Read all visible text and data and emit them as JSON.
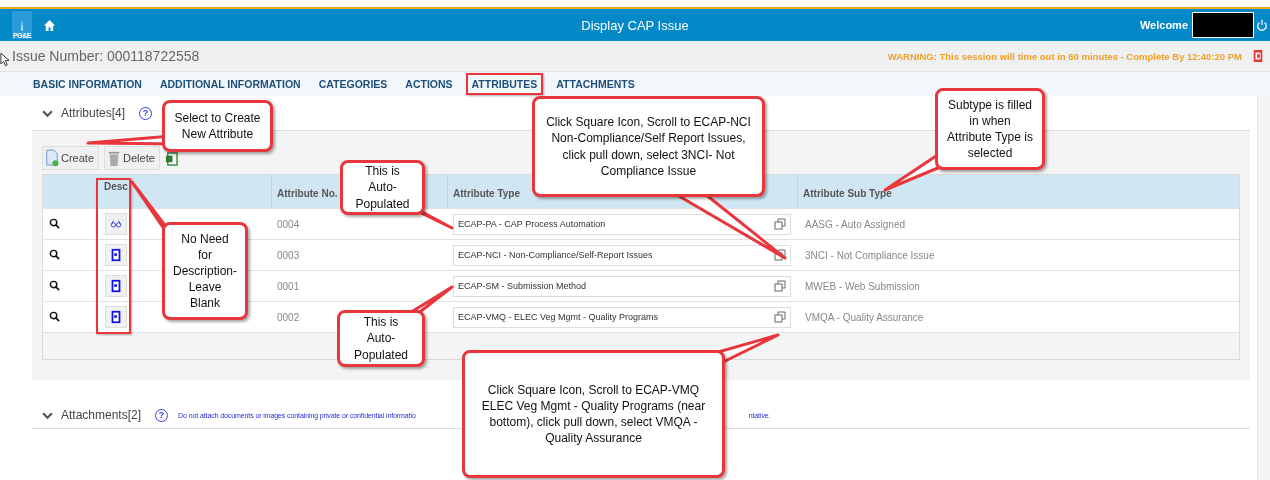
{
  "header": {
    "logo_text": "PG&E",
    "title": "Display CAP Issue",
    "welcome": "Welcome"
  },
  "issue_number": "Issue Number: 000118722558",
  "warning": "WARNING: This session will time out in 60 minutes - Complete By 12:40:20 PM",
  "tabs": [
    {
      "label": "BASIC INFORMATION",
      "annotated": false
    },
    {
      "label": "ADDITIONAL INFORMATION",
      "annotated": false
    },
    {
      "label": "CATEGORIES",
      "annotated": false
    },
    {
      "label": "ACTIONS",
      "annotated": false
    },
    {
      "label": "ATTRIBUTES",
      "annotated": true
    },
    {
      "label": "ATTACHMENTS",
      "annotated": false
    }
  ],
  "attributes_section": {
    "title": "Attributes[4]",
    "expanded": true,
    "help_label": "?",
    "toolbar": [
      "Create",
      "Delete"
    ],
    "columns": [
      {
        "label": "Desc",
        "annotated": true
      },
      {
        "label": "Attribute No.",
        "annotated": false
      },
      {
        "label": "Attribute Type",
        "annotated": false
      },
      {
        "label": "Attribute Sub Type",
        "annotated": false
      }
    ],
    "rows": [
      {
        "kind": "glasses",
        "number": "0004",
        "type": "ECAP-PA - CAP Process Automation",
        "sub_type": "AASG - Auto Assigned"
      },
      {
        "kind": "document",
        "number": "0003",
        "type": "ECAP-NCI - Non-Compliance/Self-Report Issues",
        "sub_type": "3NCI - Not Compliance Issue"
      },
      {
        "kind": "document",
        "number": "0001",
        "type": "ECAP-SM - Submission Method",
        "sub_type": "MWEB - Web Submission"
      },
      {
        "kind": "document",
        "number": "0002",
        "type": "ECAP-VMQ - ELEC Veg Mgmt - Quality Programs",
        "sub_type": "VMQA - Quality Assurance"
      }
    ]
  },
  "attachments_section": {
    "title": "Attachments[2]",
    "expanded": true,
    "help_label": "?",
    "notice_start": "Do not attach documents or images containing private or confidential informatio",
    "notice_end": "ntative."
  },
  "callouts": [
    {
      "text": "Select to Create New Attribute"
    },
    {
      "text": "Click Square Icon, Scroll to ECAP-NCI Non-Compliance/Self Report Issues, click pull down, select 3NCI- Not Compliance Issue"
    },
    {
      "text": "Subtype is filled in when Attribute Type is selected"
    },
    {
      "text": "This is Auto-Populated"
    },
    {
      "text": "No Need for Description-Leave Blank"
    },
    {
      "text": "This is Auto-Populated"
    },
    {
      "text": "Click Square Icon, Scroll to ECAP-VMQ ELEC Veg Mgmt - Quality Programs (near bottom), click pull down, select VMQA - Quality Assurance"
    }
  ]
}
